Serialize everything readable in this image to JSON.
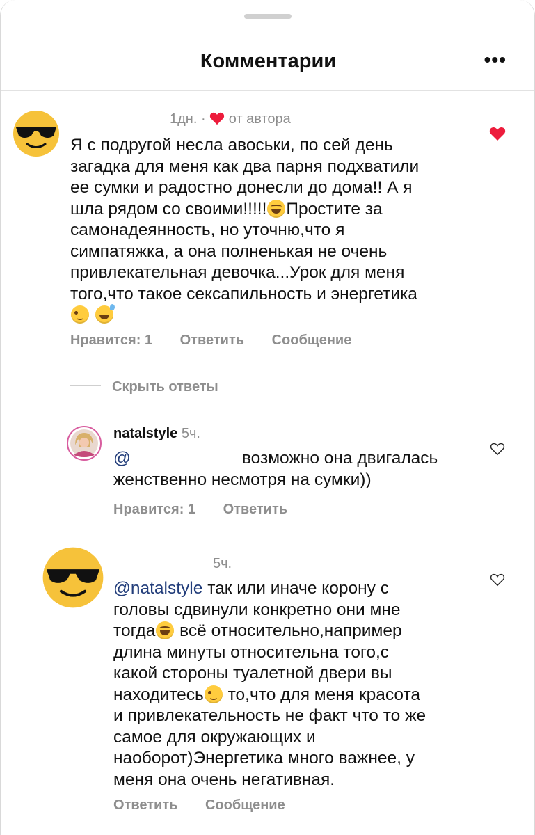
{
  "header": {
    "title": "Комментарии",
    "more_label": "•••"
  },
  "comments": [
    {
      "time": "1дн.",
      "dot": "·",
      "author_like_label": "от автора",
      "text": [
        "Я с подругой несла авоськи, по сей день",
        "загадка для меня как два парня подхватили",
        "ее сумки и радостно донесли до дома!! А я",
        "шла рядом со своими!!!!!",
        "Простите за",
        "самонадеянность, но уточню,что я",
        "симпатяжка, а она полненькая не очень",
        "привлекательная девочка...Урок для меня",
        "того,что такое сексапильность и энергетика"
      ],
      "likes_label": "Нравится: 1",
      "reply_label": "Ответить",
      "message_label": "Сообщение",
      "liked": true
    },
    {
      "hide_replies_label": "Скрыть ответы",
      "username": "natalstyle",
      "time": "5ч.",
      "mention": "@",
      "text": [
        "возможно она двигалась",
        "женственно несмотря на сумки))"
      ],
      "likes_label": "Нравится: 1",
      "reply_label": "Ответить"
    },
    {
      "time": "5ч.",
      "mention": "@natalstyle",
      "text": [
        "так или иначе корону с",
        "головы сдвинули конкретно они мне",
        "тогда",
        "всё относительно,например",
        "длина минуты относительна того,с",
        "какой стороны туалетной двери вы",
        "находитесь",
        "то,что для меня красота",
        "и привлекательность не факт что то же",
        "самое для окружающих и",
        "наоборот)Энергетика много важнее, у",
        "меня она очень негативная."
      ],
      "reply_label": "Ответить",
      "message_label": "Сообщение"
    }
  ],
  "colors": {
    "heart_red": "#ed1c3c",
    "muted": "#8e8e8e",
    "link": "#223d7a"
  }
}
